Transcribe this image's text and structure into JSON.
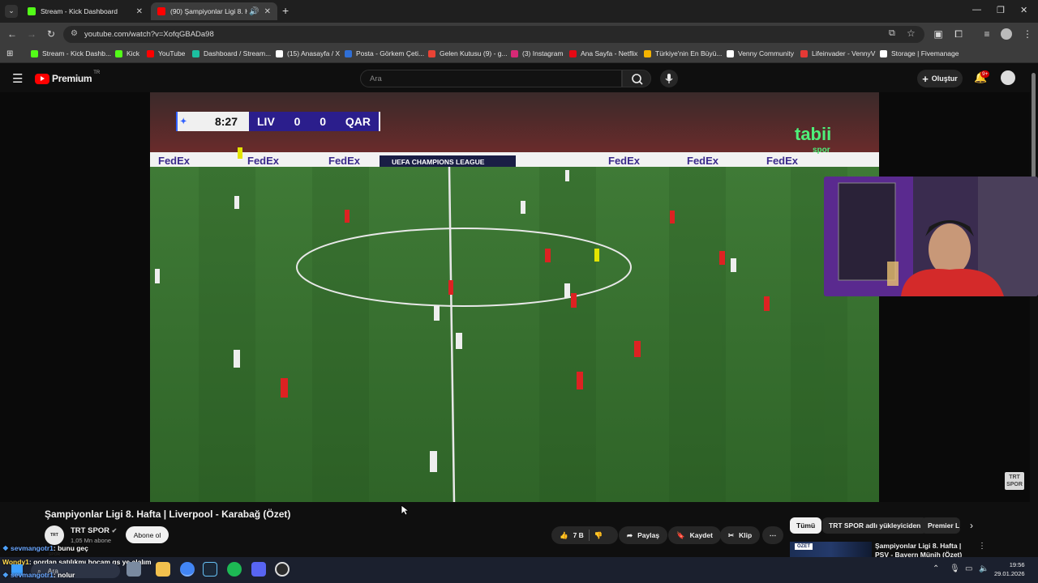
{
  "browser": {
    "tabs": [
      {
        "title": "Stream - Kick Dashboard",
        "active": false,
        "favicon_color": "#53fc18"
      },
      {
        "title": "(90) Şampiyonlar Ligi 8. Haf",
        "active": true,
        "favicon_color": "#ff0000"
      }
    ],
    "url": "youtube.com/watch?v=XofqGBADa98",
    "bookmarks": [
      {
        "label": "Stream - Kick Dashb...",
        "color": "#53fc18"
      },
      {
        "label": "Kick",
        "color": "#53fc18"
      },
      {
        "label": "YouTube",
        "color": "#ff0000"
      },
      {
        "label": "Dashboard / Stream...",
        "color": "#1cbfa0"
      },
      {
        "label": "(15) Anasayfa / X",
        "color": "#ffffff"
      },
      {
        "label": "Posta - Görkem Çeti...",
        "color": "#2f6fd6"
      },
      {
        "label": "Gelen Kutusu (9) - g...",
        "color": "#ea4335"
      },
      {
        "label": "(3) Instagram",
        "color": "#d62976"
      },
      {
        "label": "Ana Sayfa - Netflix",
        "color": "#e50914"
      },
      {
        "label": "Türkiye'nin En Büyü...",
        "color": "#f5b400"
      },
      {
        "label": "Venny Community",
        "color": "#ffffff"
      },
      {
        "label": "Lifeinvader - VennyV",
        "color": "#e53935"
      },
      {
        "label": "Storage | Fivemanage",
        "color": "#ffffff"
      }
    ]
  },
  "youtube": {
    "logo": "Premium",
    "logo_badge": "TR",
    "search_placeholder": "Ara",
    "create_label": "Oluştur",
    "notif_count": "9+",
    "video": {
      "scorebug": {
        "clock": "8:27",
        "home": "LIV",
        "home_score": "0",
        "away_score": "0",
        "away": "QAR"
      },
      "board_text": "UEFA CHAMPIONS LEAGUE",
      "ad_text": "FedEx",
      "broadcaster": "tabii",
      "broadcaster_sub": "spor",
      "watermark": "TRT SPOR"
    },
    "title": "Şampiyonlar Ligi 8. Hafta | Liverpool - Karabağ (Özet)",
    "channel": {
      "name": "TRT SPOR",
      "subs": "1,05 Mn abone",
      "avatar": "TRT SPOR",
      "subscribe": "Abone ol"
    },
    "actions": {
      "likes": "7 B",
      "share": "Paylaş",
      "save": "Kaydet",
      "clip": "Klip"
    },
    "chips": [
      "Tümü",
      "TRT SPOR adlı yükleyiciden",
      "Premier L"
    ],
    "recommended": {
      "title": "Şampiyonlar Ligi 8. Hafta | PSV - Bayern Münih (Özet)",
      "badge": "ÖZET"
    }
  },
  "chat": [
    {
      "user": "sevmangotr1",
      "text": ": bunu geç"
    },
    {
      "user": "Wondy1",
      "text": ": gordan satılıkmı hocam gs ye alalım"
    },
    {
      "user": "sevmangotr1",
      "text": ": nolur"
    }
  ],
  "taskbar": {
    "search": "Ara",
    "time": "19:56",
    "date": "29.01.2026"
  }
}
